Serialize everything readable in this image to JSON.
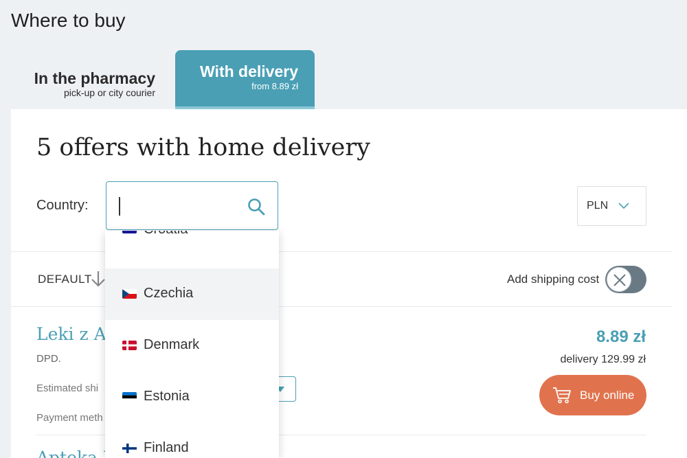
{
  "page_title": "Where to buy",
  "tabs": [
    {
      "title": "In the pharmacy",
      "subtitle": "pick-up or city courier",
      "active": false
    },
    {
      "title": "With delivery",
      "subtitle": "from 8.89 zł",
      "active": true
    }
  ],
  "offers_heading": "5 offers with home delivery",
  "country": {
    "label": "Country:",
    "value": "",
    "options": [
      {
        "name": "Croatia",
        "flag": "croatia-flag"
      },
      {
        "name": "Czechia",
        "flag": "czechia-flag",
        "highlighted": true
      },
      {
        "name": "Denmark",
        "flag": "denmark-flag"
      },
      {
        "name": "Estonia",
        "flag": "estonia-flag"
      },
      {
        "name": "Finland",
        "flag": "finland-flag"
      }
    ]
  },
  "currency": {
    "value": "PLN"
  },
  "sort": {
    "label": "DEFAULT"
  },
  "shipping_toggle": {
    "label": "Add shipping cost",
    "on": false
  },
  "offer": {
    "name": "Leki z Ap",
    "carrier": "DPD.",
    "ship_label": "Estimated shi",
    "payment_label": "Payment meth",
    "price": "8.89 zł",
    "delivery": "delivery 129.99 zł",
    "buy_label": "Buy online"
  },
  "next_offer_name": "Apteka N",
  "colors": {
    "accent": "#4a9fb5",
    "buy": "#e0734d"
  }
}
